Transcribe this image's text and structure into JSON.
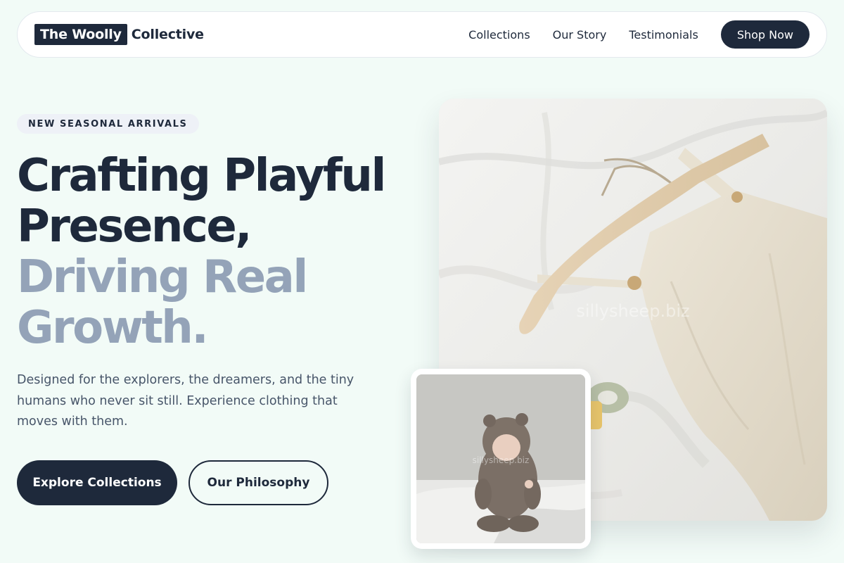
{
  "nav": {
    "brand_highlight": "The Woolly",
    "brand_rest": "Collective",
    "links": [
      {
        "label": "Collections"
      },
      {
        "label": "Our Story"
      },
      {
        "label": "Testimonials"
      }
    ],
    "cta_label": "Shop Now"
  },
  "hero": {
    "badge": "NEW SEASONAL ARRIVALS",
    "headline_dark_1": "Crafting Playful",
    "headline_dark_2": "Presence,",
    "headline_light_1": "Driving Real",
    "headline_light_2": "Growth.",
    "description": "Designed for the explorers, the dreamers, and the tiny humans who never sit still. Experience clothing that moves with them.",
    "primary_button": "Explore Collections",
    "secondary_button": "Our Philosophy"
  },
  "images": {
    "main_watermark": "sillysheep.biz",
    "thumb_watermark": "sillysheep.biz"
  },
  "colors": {
    "background": "#f2fbf7",
    "navy": "#1e293b",
    "muted_headline": "#94a3b8",
    "body_text": "#475569"
  }
}
